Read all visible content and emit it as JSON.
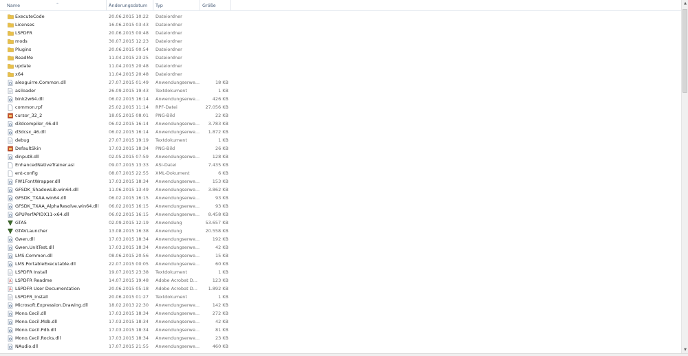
{
  "columns": {
    "name": "Name",
    "date": "Änderungsdatum",
    "type": "Typ",
    "size": "Größe"
  },
  "icons": {
    "folder": "folder-icon",
    "dll": "dll-file-icon",
    "text": "text-file-icon",
    "generic": "generic-file-icon",
    "image": "image-file-icon",
    "app": "app-icon",
    "pdf": "pdf-file-icon"
  },
  "files": [
    {
      "icon": "folder",
      "name": "ExecuteCode",
      "date": "20.06.2015 10:22",
      "type": "Dateiordner",
      "size": ""
    },
    {
      "icon": "folder",
      "name": "Licenses",
      "date": "16.06.2015 03:43",
      "type": "Dateiordner",
      "size": ""
    },
    {
      "icon": "folder",
      "name": "LSPDFR",
      "date": "20.06.2015 00:48",
      "type": "Dateiordner",
      "size": ""
    },
    {
      "icon": "folder",
      "name": "mods",
      "date": "30.07.2015 12:23",
      "type": "Dateiordner",
      "size": ""
    },
    {
      "icon": "folder",
      "name": "Plugins",
      "date": "20.06.2015 00:54",
      "type": "Dateiordner",
      "size": ""
    },
    {
      "icon": "folder",
      "name": "ReadMe",
      "date": "11.04.2015 23:25",
      "type": "Dateiordner",
      "size": ""
    },
    {
      "icon": "folder",
      "name": "update",
      "date": "11.04.2015 20:48",
      "type": "Dateiordner",
      "size": ""
    },
    {
      "icon": "folder",
      "name": "x64",
      "date": "11.04.2015 20:48",
      "type": "Dateiordner",
      "size": ""
    },
    {
      "icon": "dll",
      "name": "alexguirre.Common.dll",
      "date": "27.07.2015 01:49",
      "type": "Anwendungserwe...",
      "size": "18 KB"
    },
    {
      "icon": "text",
      "name": "asiloader",
      "date": "26.09.2015 19:43",
      "type": "Textdokument",
      "size": "1 KB"
    },
    {
      "icon": "dll",
      "name": "bink2w64.dll",
      "date": "06.02.2015 16:14",
      "type": "Anwendungserwe...",
      "size": "426 KB"
    },
    {
      "icon": "generic",
      "name": "common.rpf",
      "date": "25.02.2015 11:14",
      "type": "RPF-Datei",
      "size": "27.056 KB"
    },
    {
      "icon": "image",
      "name": "cursor_32_2",
      "date": "18.05.2015 08:01",
      "type": "PNG-Bild",
      "size": "22 KB"
    },
    {
      "icon": "dll",
      "name": "d3dcompiler_46.dll",
      "date": "06.02.2015 16:14",
      "type": "Anwendungserwe...",
      "size": "3.783 KB"
    },
    {
      "icon": "dll",
      "name": "d3dcsx_46.dll",
      "date": "06.02.2015 16:14",
      "type": "Anwendungserwe...",
      "size": "1.872 KB"
    },
    {
      "icon": "text",
      "name": "debug",
      "date": "27.07.2015 19:19",
      "type": "Textdokument",
      "size": "1 KB"
    },
    {
      "icon": "image",
      "name": "DefaultSkin",
      "date": "17.03.2015 18:34",
      "type": "PNG-Bild",
      "size": "26 KB"
    },
    {
      "icon": "dll",
      "name": "dinput8.dll",
      "date": "02.05.2015 07:59",
      "type": "Anwendungserwe...",
      "size": "128 KB"
    },
    {
      "icon": "generic",
      "name": "EnhancedNativeTrainer.asi",
      "date": "09.07.2015 13:33",
      "type": "ASI-Datei",
      "size": "7.435 KB"
    },
    {
      "icon": "generic",
      "name": "ent-config",
      "date": "08.07.2015 22:55",
      "type": "XML-Dokument",
      "size": "6 KB"
    },
    {
      "icon": "dll",
      "name": "FW1FontWrapper.dll",
      "date": "17.03.2015 18:34",
      "type": "Anwendungserwe...",
      "size": "153 KB"
    },
    {
      "icon": "dll",
      "name": "GFSDK_ShadowLib.win64.dll",
      "date": "11.06.2015 13:49",
      "type": "Anwendungserwe...",
      "size": "3.862 KB"
    },
    {
      "icon": "dll",
      "name": "GFSDK_TXAA.win64.dll",
      "date": "06.02.2015 16:15",
      "type": "Anwendungserwe...",
      "size": "93 KB"
    },
    {
      "icon": "dll",
      "name": "GFSDK_TXAA_AlphaResolve.win64.dll",
      "date": "06.02.2015 16:15",
      "type": "Anwendungserwe...",
      "size": "93 KB"
    },
    {
      "icon": "dll",
      "name": "GPUPerfAPIDX11-x64.dll",
      "date": "06.02.2015 16:15",
      "type": "Anwendungserwe...",
      "size": "8.458 KB"
    },
    {
      "icon": "app",
      "name": "GTA5",
      "date": "02.09.2015 12:19",
      "type": "Anwendung",
      "size": "53.657 KB"
    },
    {
      "icon": "app",
      "name": "GTAVLauncher",
      "date": "13.08.2015 16:38",
      "type": "Anwendung",
      "size": "20.558 KB"
    },
    {
      "icon": "dll",
      "name": "Gwen.dll",
      "date": "17.03.2015 18:34",
      "type": "Anwendungserwe...",
      "size": "192 KB"
    },
    {
      "icon": "dll",
      "name": "Gwen.UnitTest.dll",
      "date": "17.03.2015 18:34",
      "type": "Anwendungserwe...",
      "size": "42 KB"
    },
    {
      "icon": "dll",
      "name": "LMS.Common.dll",
      "date": "08.06.2015 20:56",
      "type": "Anwendungserwe...",
      "size": "15 KB"
    },
    {
      "icon": "dll",
      "name": "LMS.PortableExecutable.dll",
      "date": "22.07.2015 00:05",
      "type": "Anwendungserwe...",
      "size": "60 KB"
    },
    {
      "icon": "text",
      "name": "LSPDFR Install",
      "date": "19.07.2015 23:38",
      "type": "Textdokument",
      "size": "1 KB"
    },
    {
      "icon": "pdf",
      "name": "LSPDFR Readme",
      "date": "14.07.2015 19:48",
      "type": "Adobe Acrobat D...",
      "size": "123 KB"
    },
    {
      "icon": "pdf",
      "name": "LSPDFR User Documentation",
      "date": "20.06.2015 05:18",
      "type": "Adobe Acrobat D...",
      "size": "1.892 KB"
    },
    {
      "icon": "text",
      "name": "LSPDFR_Install",
      "date": "20.06.2015 01:27",
      "type": "Textdokument",
      "size": "1 KB"
    },
    {
      "icon": "dll",
      "name": "Microsoft.Expression.Drawing.dll",
      "date": "18.02.2013 22:30",
      "type": "Anwendungserwe...",
      "size": "142 KB"
    },
    {
      "icon": "dll",
      "name": "Mono.Cecil.dll",
      "date": "17.03.2015 18:34",
      "type": "Anwendungserwe...",
      "size": "272 KB"
    },
    {
      "icon": "dll",
      "name": "Mono.Cecil.Mdb.dll",
      "date": "17.03.2015 18:34",
      "type": "Anwendungserwe...",
      "size": "42 KB"
    },
    {
      "icon": "dll",
      "name": "Mono.Cecil.Pdb.dll",
      "date": "17.03.2015 18:34",
      "type": "Anwendungserwe...",
      "size": "81 KB"
    },
    {
      "icon": "dll",
      "name": "Mono.Cecil.Rocks.dll",
      "date": "17.03.2015 18:34",
      "type": "Anwendungserwe...",
      "size": "23 KB"
    },
    {
      "icon": "dll",
      "name": "NAudio.dll",
      "date": "17.07.2015 21:55",
      "type": "Anwendungserwe...",
      "size": "460 KB"
    }
  ],
  "colors": {
    "folder": "#e8c04a",
    "header_text": "#4c607a",
    "secondary_text": "#6d6d6d",
    "pdf": "#c62828",
    "app": "#3e6b2c"
  }
}
